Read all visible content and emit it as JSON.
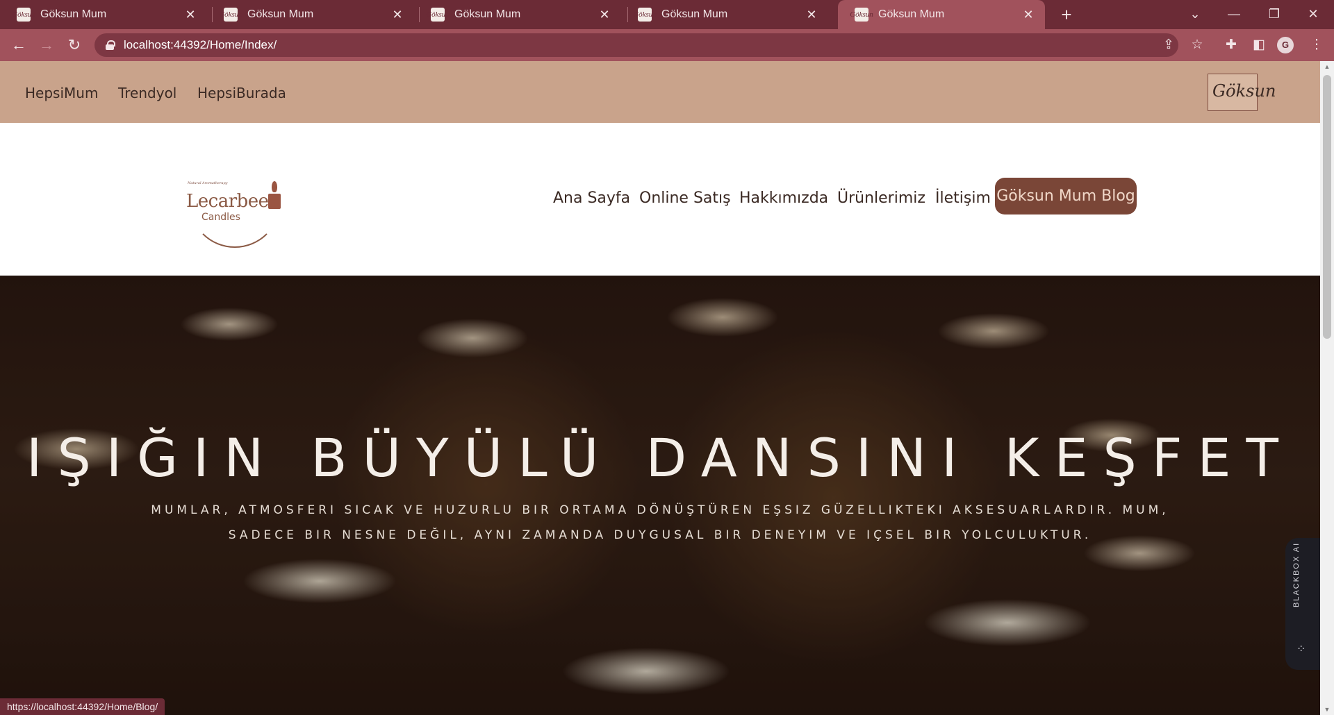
{
  "browser": {
    "tabs": [
      {
        "title": "Göksun Mum",
        "active": false
      },
      {
        "title": "Göksun Mum",
        "active": false
      },
      {
        "title": "Göksun Mum",
        "active": false
      },
      {
        "title": "Göksun Mum",
        "active": false
      },
      {
        "title": "Göksun Mum",
        "active": true
      }
    ],
    "favicon_text": "Göksun",
    "url": "localhost:44392/Home/Index/",
    "profile_initial": "G",
    "status_url": "https://localhost:44392/Home/Blog/"
  },
  "topbar": {
    "links": [
      "HepsiMum",
      "Trendyol",
      "HepsiBurada"
    ],
    "brand_logo_text": "Göksun"
  },
  "logo": {
    "tagline": "Natural Aromatherapy",
    "word": "Lecarbee",
    "sub": "Candles"
  },
  "nav": {
    "items": [
      "Ana Sayfa",
      "Online Satış",
      "Hakkımızda",
      "Ürünlerimiz",
      "İletişim"
    ],
    "blog_button": "Göksun Mum Blog"
  },
  "hero": {
    "title": "IŞIĞIN BÜYÜLÜ DANSINI KEŞFET",
    "subtitle_line1": "Mumlar, atmosferi sıcak ve huzurlu bir ortama dönüştüren eşsiz güzellikteki aksesuarlardır. Mum,",
    "subtitle_line2": "sadece bir nesne değil, aynı zamanda duygusal bir deneyim ve içsel bir yolculuktur."
  },
  "sidetab": {
    "label": "BLACKBOX AI"
  },
  "colors": {
    "chrome": "#6b2b36",
    "chrome_active": "#a1525c",
    "topstrip": "#c9a38b",
    "blog_button": "#7a4637"
  },
  "icons": [
    "back-icon",
    "forward-icon",
    "reload-icon",
    "lock-icon",
    "share-icon",
    "star-icon",
    "extensions-icon",
    "sidepanel-icon",
    "menu-icon",
    "close-icon",
    "plus-icon",
    "minimize-icon",
    "restore-icon",
    "chevron-down-icon"
  ]
}
